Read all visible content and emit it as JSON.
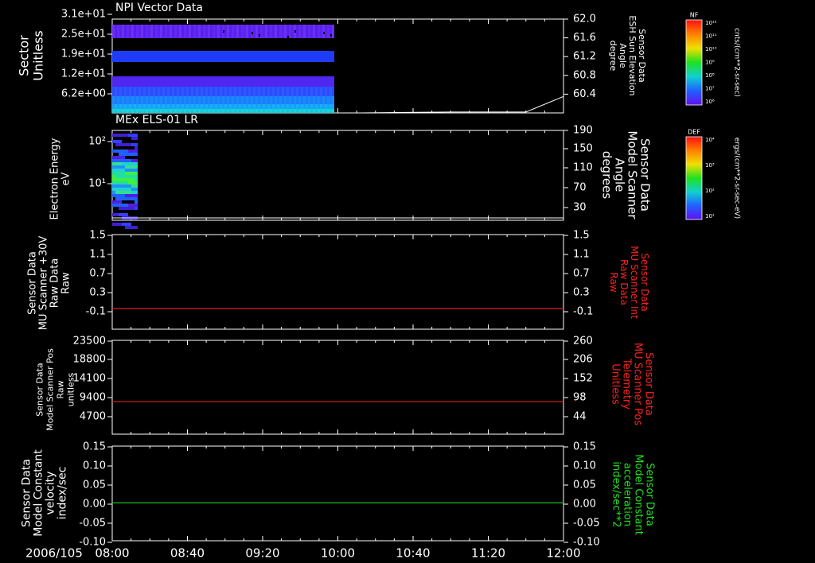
{
  "chart_data": [
    {
      "type": "heatmap",
      "title": "NPI Vector Data",
      "ylabel_left": [
        "Sector",
        "Unitless"
      ],
      "ylabel_right": [
        "Sensor Data",
        "ESH Sun Elevation",
        "Angle",
        "degree"
      ],
      "yticks_left": [
        "3.1e+01",
        "2.5e+01",
        "1.9e+01",
        "1.2e+01",
        "6.2e+00"
      ],
      "yticks_right": [
        "62.0",
        "61.6",
        "61.2",
        "60.8",
        "60.4"
      ],
      "ylim_right": [
        60.0,
        62.0
      ],
      "colorbar": {
        "label": "NF",
        "unit": "cnts/(cm**2-sr-sec)",
        "ticks": [
          "10¹²",
          "10¹¹",
          "10¹⁰",
          "10⁹",
          "10⁸",
          "10⁷",
          "10⁶"
        ]
      },
      "data_time_range": [
        "08:00",
        "09:58"
      ],
      "bands": [
        {
          "sector_range": [
            23,
            29
          ],
          "level": "medium"
        },
        {
          "sector_range": [
            16,
            18
          ],
          "level": "medium"
        },
        {
          "sector_range": [
            0,
            12
          ],
          "level": "low-to-high"
        }
      ],
      "line_series": {
        "name": "ESH Sun Elevation Angle",
        "x": [
          "10:12",
          "11:00",
          "11:40",
          "12:00"
        ],
        "y": [
          60.0,
          60.02,
          60.02,
          60.35
        ]
      }
    },
    {
      "type": "heatmap",
      "title": "MEx ELS-01 LR",
      "ylabel_left": [
        "Electron Energy",
        "eV"
      ],
      "ylabel_right": [
        "Sensor Data",
        "Model Scanner",
        "Angle",
        "degrees"
      ],
      "yticks_left": [
        "10²",
        "10¹"
      ],
      "yticks_right": [
        "190",
        "150",
        "110",
        "70",
        "30"
      ],
      "ylim_right": [
        0,
        190
      ],
      "colorbar": {
        "label": "DEF",
        "unit": "ergs/(cm**2-sr-sec-eV)",
        "ticks": [
          "10⁴",
          "10³",
          "10²",
          "10¹"
        ]
      },
      "data_time_range": [
        "08:00",
        "08:12"
      ],
      "line_series": {
        "name": "Model Scanner Angle",
        "x": [
          "08:00",
          "12:00"
        ],
        "y": [
          0,
          0
        ]
      }
    },
    {
      "type": "line",
      "ylabel_left": [
        "Sensor Data",
        "MU Scanner +30V",
        "Raw Data",
        "Raw"
      ],
      "ylabel_right": [
        "Sensor Data",
        "MU Scanner Int",
        "Raw Data",
        "Raw"
      ],
      "yticks_left": [
        "1.5",
        "1.1",
        "0.7",
        "0.3",
        "-0.1"
      ],
      "yticks_right": [
        "1.5",
        "1.1",
        "0.7",
        "0.3",
        "-0.1"
      ],
      "ylim": [
        -0.42,
        1.5
      ],
      "series": [
        {
          "color": "#e02020",
          "x": [
            "08:00",
            "12:00"
          ],
          "y": [
            0.0,
            0.0
          ]
        }
      ]
    },
    {
      "type": "line",
      "ylabel_left": [
        "Sensor Data",
        "Model Scanner Pos",
        "Raw",
        "unitless"
      ],
      "ylabel_right": [
        "Sensor Data",
        "MU Scanner Pos",
        "Telemetry",
        "Unitless"
      ],
      "yticks_left": [
        "23500",
        "18800",
        "14100",
        "9400",
        "4700"
      ],
      "yticks_right": [
        "260",
        "206",
        "152",
        "98",
        "44"
      ],
      "ylim": [
        0,
        23500
      ],
      "series": [
        {
          "color": "#e02020",
          "x": [
            "08:00",
            "12:00"
          ],
          "y": [
            8150,
            8150
          ]
        }
      ]
    },
    {
      "type": "line",
      "ylabel_left": [
        "Sensor Data",
        "Model Constant",
        "velocity",
        "index/sec"
      ],
      "ylabel_right": [
        "Sensor Data",
        "Model Constant",
        "acceleration",
        "index/sec**2"
      ],
      "yticks_left": [
        "0.15",
        "0.10",
        "0.05",
        "0.00",
        "-0.05",
        "-0.10"
      ],
      "yticks_right": [
        "0.15",
        "0.10",
        "0.05",
        "0.00",
        "-0.05",
        "-0.10"
      ],
      "ylim": [
        -0.1,
        0.15
      ],
      "series": [
        {
          "color": "#20c020",
          "x": [
            "08:00",
            "12:00"
          ],
          "y": [
            0.0,
            0.0
          ]
        }
      ]
    }
  ],
  "x_axis": {
    "date": "2006/105",
    "ticks": [
      "08:00",
      "08:40",
      "09:20",
      "10:00",
      "10:40",
      "11:20",
      "12:00"
    ],
    "range": [
      "08:00",
      "12:00"
    ]
  },
  "colors": {
    "axis": "#ffffff",
    "right_label_red": "#ff2020",
    "right_label_green": "#20e020"
  }
}
